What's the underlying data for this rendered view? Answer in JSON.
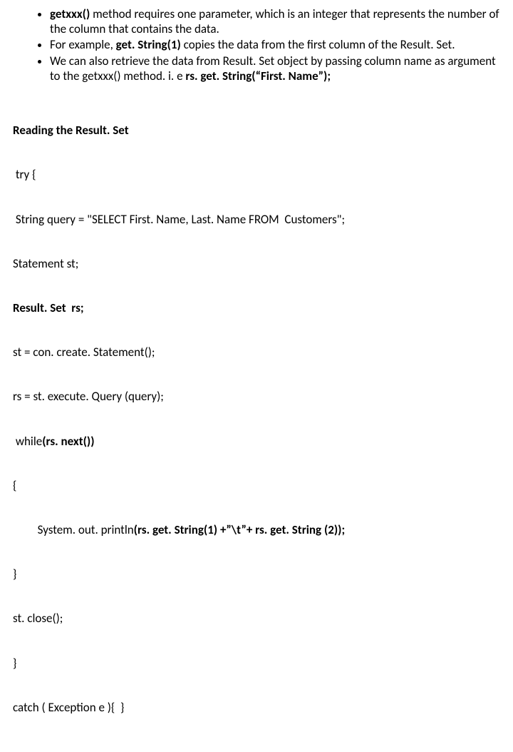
{
  "bullets": [
    {
      "segments": [
        {
          "text": "getxxx()",
          "bold": true
        },
        {
          "text": " method requires one parameter, which is an integer that represents the number of the column that contains the data.",
          "bold": false
        }
      ]
    },
    {
      "segments": [
        {
          "text": "For example, ",
          "bold": false
        },
        {
          "text": "get. String(1)",
          "bold": true
        },
        {
          "text": " copies the data from the first column of the Result. Set.",
          "bold": false
        }
      ]
    },
    {
      "segments": [
        {
          "text": "We can also retrieve the data from Result. Set object by passing column name as argument to the getxxx() method. i. e   ",
          "bold": false
        },
        {
          "text": "rs. get. String(“First. Name”);",
          "bold": true
        }
      ]
    }
  ],
  "code": [
    [
      {
        "text": "Reading the Result. Set",
        "bold": true
      }
    ],
    [
      {
        "text": " try {",
        "bold": false
      }
    ],
    [
      {
        "text": " String query = \"SELECT First. Name, Last. Name FROM  Customers\";",
        "bold": false
      }
    ],
    [
      {
        "text": "Statement st;",
        "bold": false
      }
    ],
    [
      {
        "text": "Result. Set  rs;",
        "bold": true
      }
    ],
    [
      {
        "text": "st = con. create. Statement();",
        "bold": false
      }
    ],
    [
      {
        "text": "rs = st. execute. Query (query);",
        "bold": false
      }
    ],
    [
      {
        "text": " while",
        "bold": false
      },
      {
        "text": "(rs. next())",
        "bold": true
      }
    ],
    [
      {
        "text": "{",
        "bold": false
      }
    ],
    [
      {
        "text": "         System. out. println",
        "bold": false
      },
      {
        "text": "(rs. get. String(1) +”\\t”+ rs. get. String (2));",
        "bold": true
      }
    ],
    [
      {
        "text": "}",
        "bold": false
      }
    ],
    [
      {
        "text": "st. close();",
        "bold": false
      }
    ],
    [
      {
        "text": "}",
        "bold": false
      }
    ],
    [
      {
        "text": "catch ( Exception e ){  }",
        "bold": false
      }
    ]
  ]
}
